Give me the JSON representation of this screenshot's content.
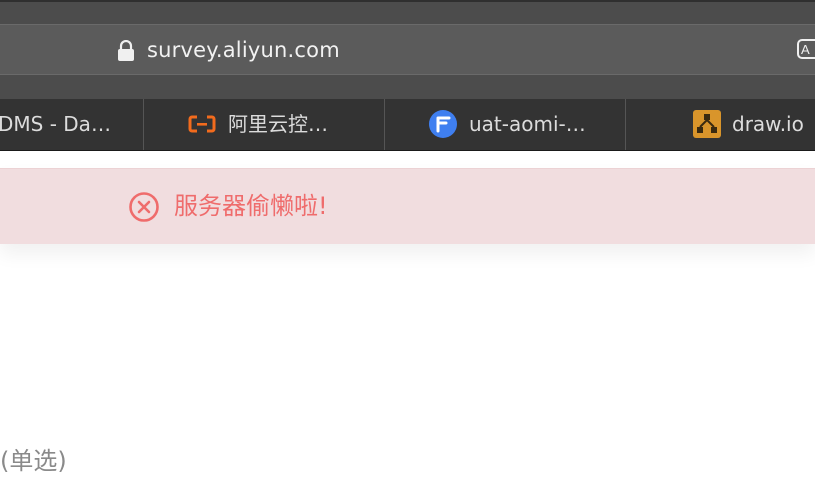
{
  "browser": {
    "url": "survey.aliyun.com",
    "tabs": [
      {
        "label": "DMS - Da…",
        "icon": "dms-favicon"
      },
      {
        "label": "阿里云控…",
        "icon": "aliyun-favicon",
        "color": "#f26b1d"
      },
      {
        "label": "uat-aomi-…",
        "icon": "aomi-favicon",
        "color": "#3f7ff0"
      },
      {
        "label": "draw.io",
        "icon": "drawio-favicon",
        "color": "#d9952b"
      }
    ]
  },
  "error": {
    "message": "服务器偷懒啦!",
    "color": "#ef6c6c",
    "background": "#f1dddf"
  },
  "question": {
    "hint": "(单选)"
  }
}
